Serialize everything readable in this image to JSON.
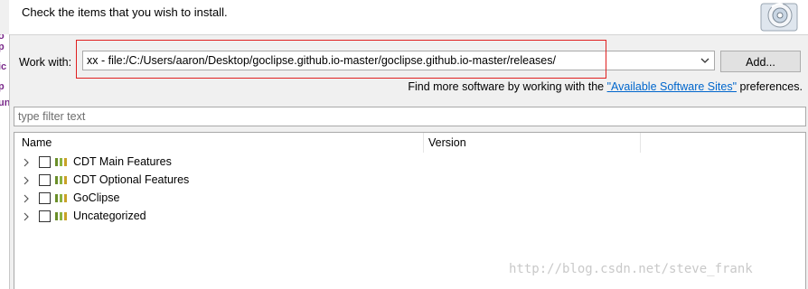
{
  "header": {
    "instruction": "Check the items that you wish to install.",
    "icon": "install-disc-icon"
  },
  "left_fragments": [
    "o",
    "p",
    "ic",
    "p",
    "un"
  ],
  "work_with": {
    "label": "Work with:",
    "value": "xx - file:/C:/Users/aaron/Desktop/goclipse.github.io-master/goclipse.github.io-master/releases/",
    "add_button": "Add..."
  },
  "find_more": {
    "prefix": "Find more software by working with the ",
    "link": "\"Available Software Sites\"",
    "suffix": " preferences."
  },
  "filter": {
    "placeholder": "type filter text"
  },
  "table": {
    "columns": [
      "Name",
      "Version"
    ],
    "rows": [
      {
        "label": "CDT Main Features",
        "checked": false
      },
      {
        "label": "CDT Optional Features",
        "checked": false
      },
      {
        "label": "GoClipse",
        "checked": false
      },
      {
        "label": "Uncategorized",
        "checked": false
      }
    ]
  },
  "highlight_color": "#e02020",
  "watermark": "http://blog.csdn.net/steve_frank"
}
